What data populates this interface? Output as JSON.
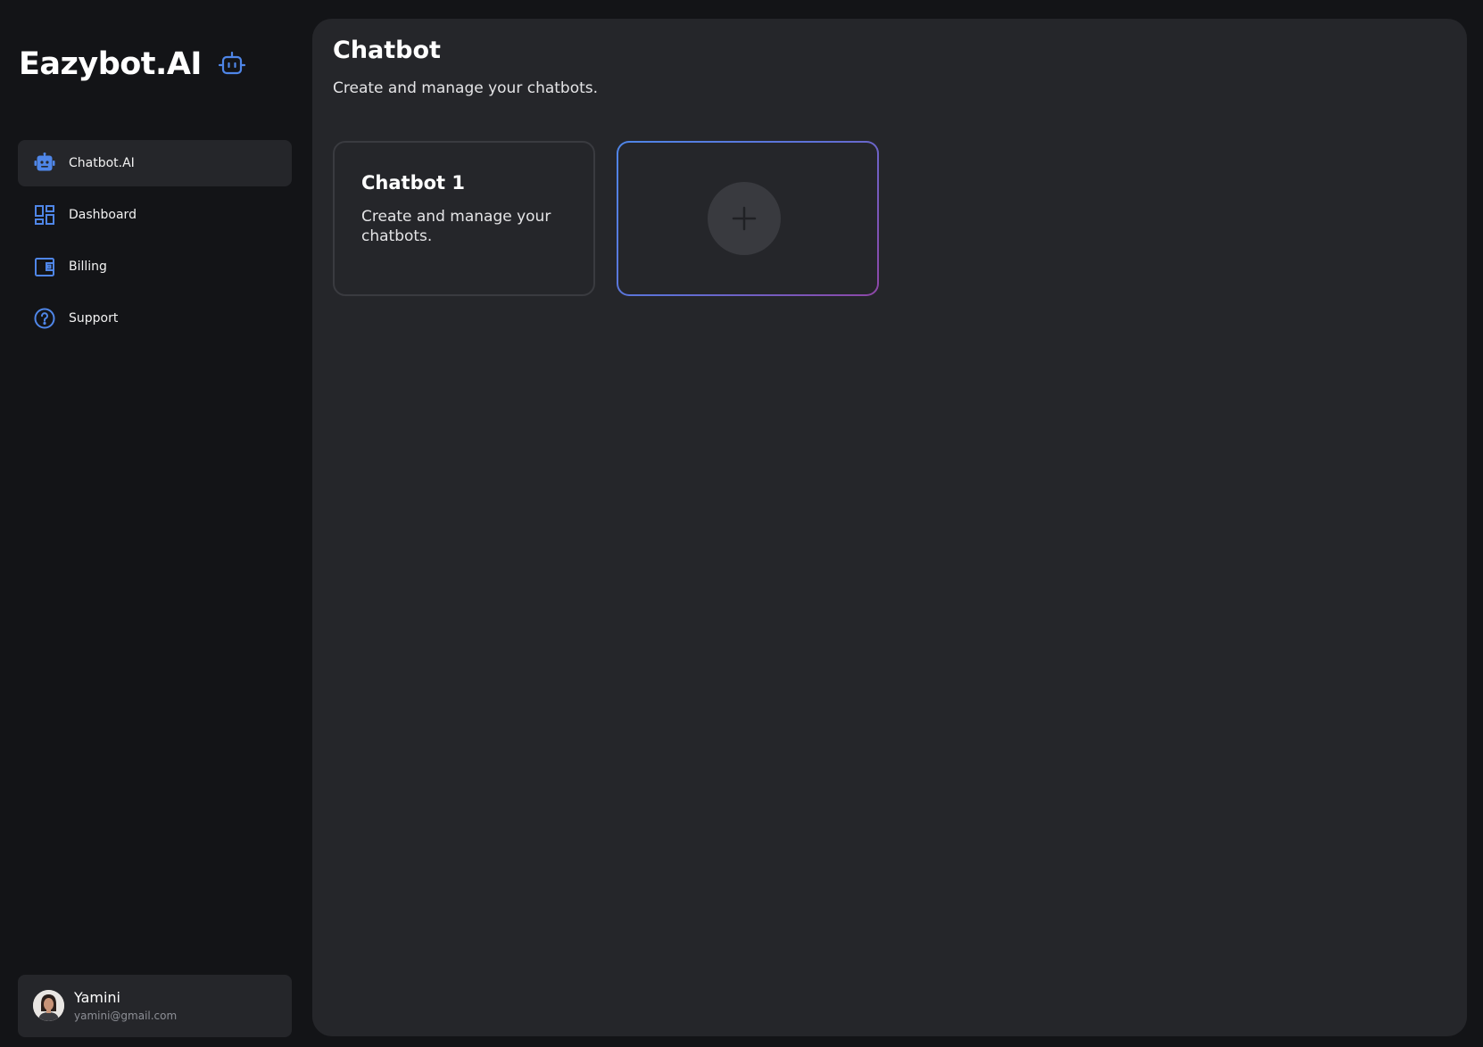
{
  "brand": {
    "name": "Eazybot.AI",
    "icon": "robot-icon",
    "accent": "#4f86e8"
  },
  "sidebar": {
    "items": [
      {
        "label": "Chatbot.AI",
        "icon": "robot-icon",
        "active": true
      },
      {
        "label": "Dashboard",
        "icon": "dashboard-icon",
        "active": false
      },
      {
        "label": "Billing",
        "icon": "wallet-icon",
        "active": false
      },
      {
        "label": "Support",
        "icon": "help-circle-icon",
        "active": false
      }
    ]
  },
  "user": {
    "name": "Yamini",
    "email": "yamini@gmail.com"
  },
  "main": {
    "title": "Chatbot",
    "subtitle": "Create and manage your chatbots.",
    "cards": [
      {
        "title": "Chatbot 1",
        "description": "Create and manage your chatbots."
      }
    ],
    "add_card": {
      "icon": "plus-icon"
    }
  },
  "colors": {
    "background": "#131417",
    "panel": "#25262a",
    "icon_blue": "#4f86e8",
    "gradient_start": "#4f86e8",
    "gradient_end": "#8e46a6"
  }
}
